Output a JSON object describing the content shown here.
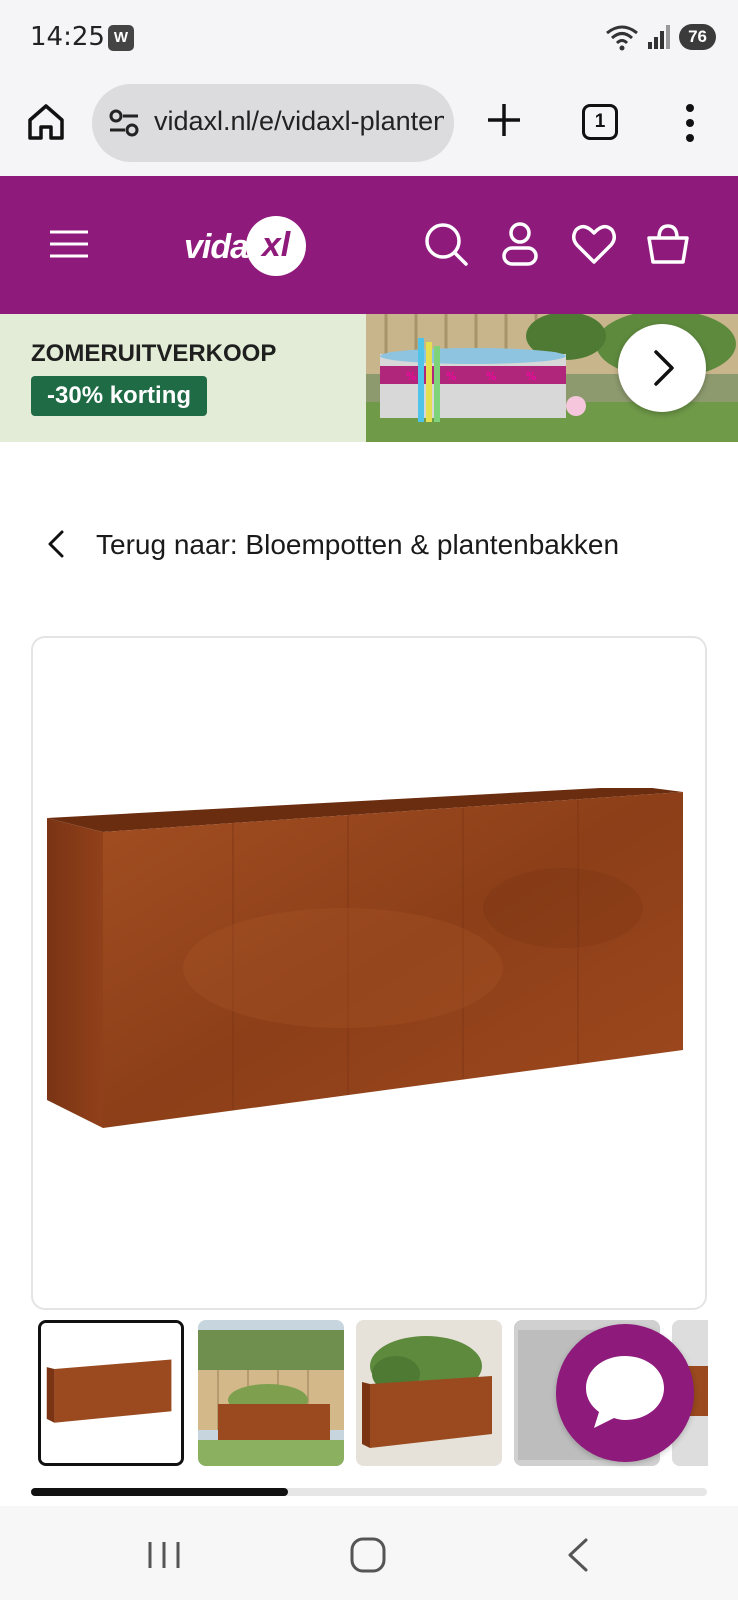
{
  "status_bar": {
    "time": "14:25",
    "app_badge": "W",
    "battery": "76"
  },
  "browser": {
    "url": "vidaxl.nl/e/vidaxl-plantenbak",
    "tab_count": "1"
  },
  "site": {
    "logo_text_left": "vida",
    "logo_text_circle": "xl",
    "brand_color": "#8e1a7b"
  },
  "promo": {
    "title": "ZOMERUITVERKOOP",
    "badge": "-30% korting",
    "badge_color": "#1f6b45"
  },
  "back_link": {
    "label": "Terug naar: Bloempotten & plantenbakken"
  },
  "gallery": {
    "thumbnails": [
      "product-front",
      "garden-fence",
      "planted-bushes",
      "grey-wall"
    ],
    "selected_index": 0,
    "scroll_progress": 0.38
  },
  "icons": {
    "home": "home-icon",
    "site_settings": "site-settings-icon",
    "new_tab": "plus-icon",
    "menu": "more-vert-icon",
    "hamburger": "hamburger-menu-icon",
    "search": "search-icon",
    "account": "user-icon",
    "wishlist": "heart-icon",
    "cart": "cart-icon",
    "next": "chevron-right-icon",
    "back": "chevron-left-icon",
    "chat": "chat-bubble-icon"
  }
}
